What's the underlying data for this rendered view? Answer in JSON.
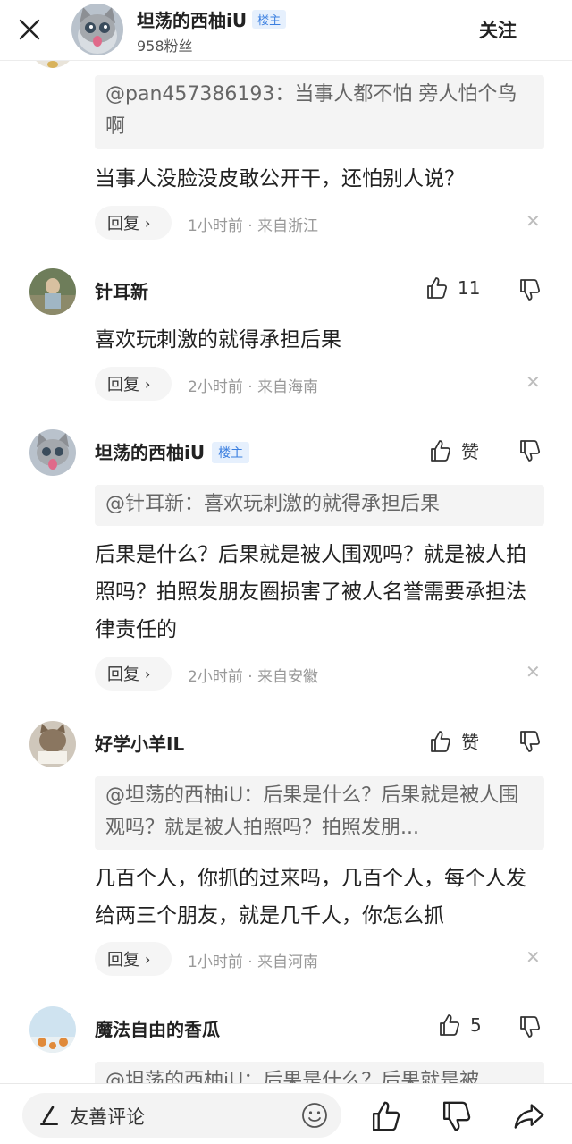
{
  "header": {
    "name": "坦荡的西柚iU",
    "badge": "楼主",
    "fans": "958粉丝",
    "follow": "关注"
  },
  "comments": [
    {
      "quote": "@pan457386193：当事人都不怕 旁人怕个鸟啊",
      "text": "当事人没脸没皮敢公开干，还怕别人说？",
      "reply": "回复",
      "meta": "1小时前 · 来自浙江"
    },
    {
      "name": "针耳新",
      "likes": "11",
      "text": "喜欢玩刺激的就得承担后果",
      "reply": "回复",
      "meta": "2小时前 · 来自海南"
    },
    {
      "name": "坦荡的西柚iU",
      "badge": "楼主",
      "likes": "赞",
      "quote": "@针耳新：喜欢玩刺激的就得承担后果",
      "text": "后果是什么？后果就是被人围观吗？就是被人拍照吗？拍照发朋友圈损害了被人名誉需要承担法律责任的",
      "reply": "回复",
      "meta": "2小时前 · 来自安徽"
    },
    {
      "name": "好学小羊IL",
      "likes": "赞",
      "quote": "@坦荡的西柚iU：后果是什么？后果就是被人围观吗？就是被人拍照吗？拍照发朋...",
      "text": "几百个人，你抓的过来吗，几百个人，每个人发给两三个朋友，就是几千人，你怎么抓",
      "reply": "回复",
      "meta": "1小时前 · 来自河南"
    },
    {
      "name": "魔法自由的香瓜",
      "likes": "5",
      "quote": "@坦荡的西柚iU：后果是什么？后果就是被"
    }
  ],
  "bottom": {
    "placeholder": "友善评论"
  },
  "icons": {
    "close": "close-icon",
    "like": "thumbs-up-icon",
    "dislike": "thumbs-down-icon",
    "pen": "pen-icon",
    "emoji": "emoji-icon",
    "share": "share-icon",
    "chevron": "chevron-right-icon",
    "dismiss": "dismiss-x-icon"
  },
  "colors": {
    "accent_blue": "#3b7fe0",
    "badge_bg": "#e6f0fd",
    "quote_bg": "#f4f4f4",
    "meta_gray": "#999999"
  }
}
